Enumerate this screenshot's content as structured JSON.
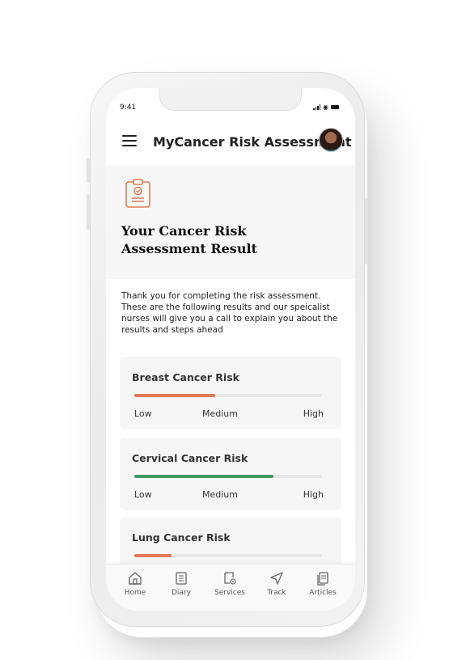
{
  "status_bar": {
    "time": "9:41"
  },
  "header": {
    "title": "MyCancer Risk Assessment",
    "menu_icon": "hamburger-menu-icon",
    "avatar_icon": "user-avatar"
  },
  "result": {
    "icon": "clipboard-check-icon",
    "title": "Your Cancer Risk Assessment Result",
    "intro": "Thank you for completing the risk assessment. These are the following results and our speicalist nurses will give you a call to explain you about the results and steps ahead"
  },
  "risks": [
    {
      "title": "Breast Cancer Risk",
      "level": 0.43,
      "color": "#e07a57",
      "low": "Low",
      "medium": "Medium",
      "high": "High"
    },
    {
      "title": "Cervical Cancer Risk",
      "level": 0.74,
      "color": "#3f9a5f",
      "low": "Low",
      "medium": "Medium",
      "high": "High"
    },
    {
      "title": "Lung Cancer Risk",
      "level": 0.2,
      "color": "#e07a57"
    }
  ],
  "nav": [
    {
      "label": "Home",
      "icon": "home-icon"
    },
    {
      "label": "Diary",
      "icon": "diary-icon"
    },
    {
      "label": "Services",
      "icon": "services-icon"
    },
    {
      "label": "Track",
      "icon": "track-icon"
    },
    {
      "label": "Articles",
      "icon": "articles-icon"
    }
  ],
  "colors": {
    "accent": "#e07a57",
    "green": "#3f9a5f"
  }
}
